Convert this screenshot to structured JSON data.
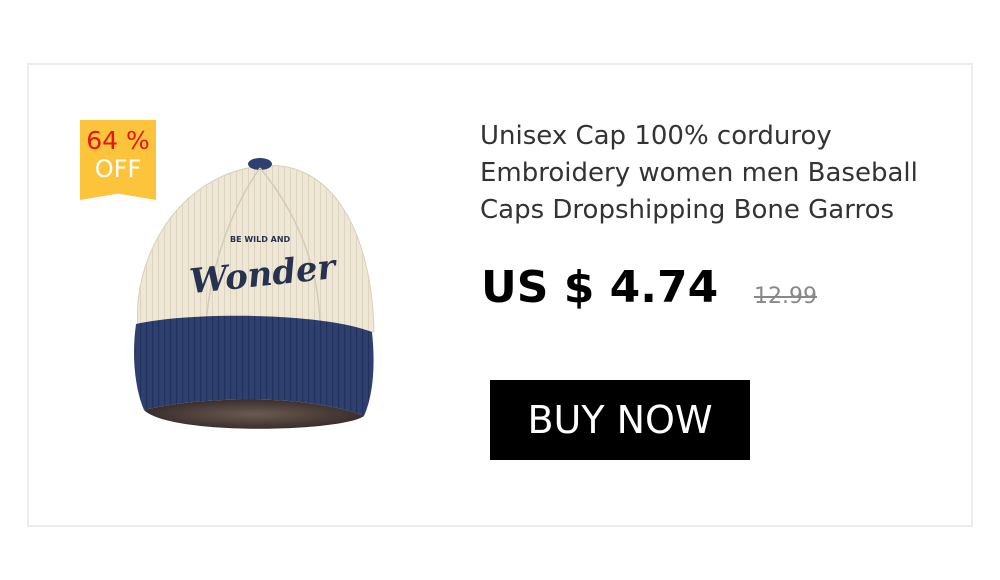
{
  "product": {
    "title": "Unisex Cap 100% corduroy Embroidery women men Baseball Caps Dropshipping Bone Garros",
    "price": "US $ 4.74",
    "original_price": "12.99",
    "image": {
      "icon": "baseball-cap-icon",
      "embroidery_small": "BE WILD AND",
      "embroidery_main": "Wonder"
    }
  },
  "badge": {
    "percent": "64 %",
    "off": "OFF"
  },
  "actions": {
    "buy_label": "BUY NOW"
  },
  "colors": {
    "badge_bg": "#fcc43b",
    "badge_percent": "#e4161c",
    "cap_crown": "#efe9d9",
    "cap_brim": "#2e3f6e",
    "button_bg": "#000000"
  }
}
